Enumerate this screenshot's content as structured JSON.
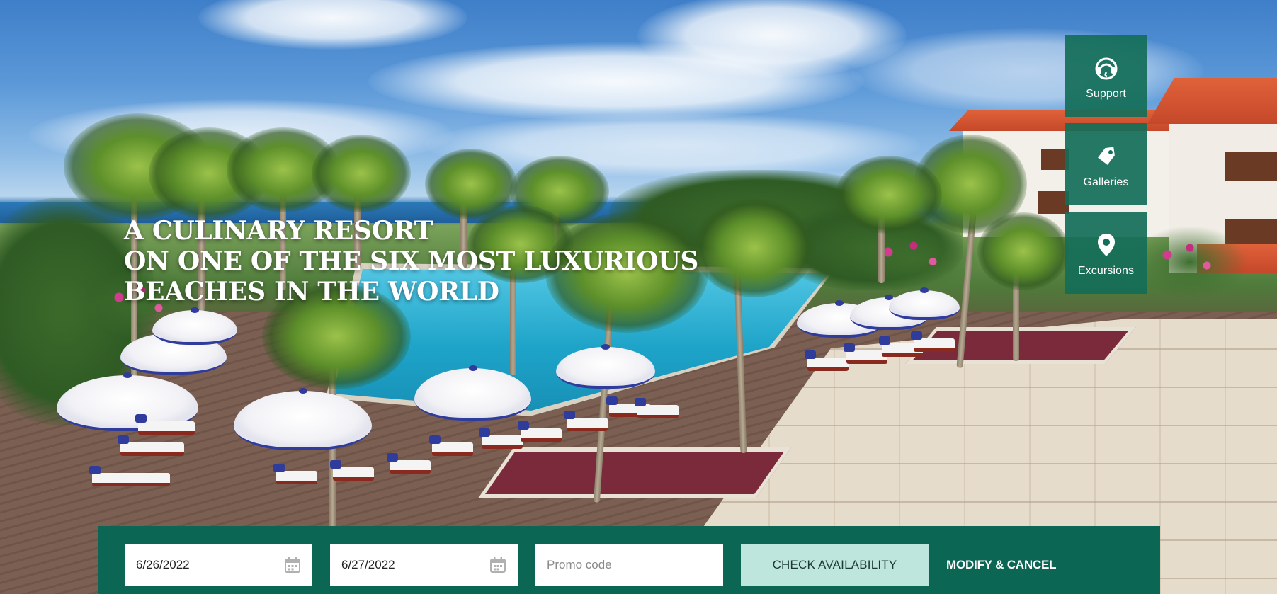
{
  "hero": {
    "headline_lines": [
      "A CULINARY RESORT",
      "ON ONE OF THE SIX MOST LUXURIOUS",
      "BEACHES IN THE WORLD"
    ]
  },
  "side_nav": {
    "items": [
      {
        "label": "Support",
        "icon": "headset-icon"
      },
      {
        "label": "Galleries",
        "icon": "tag-icon"
      },
      {
        "label": "Excursions",
        "icon": "map-pin-icon"
      }
    ]
  },
  "booking": {
    "arrival_date": "6/26/2022",
    "departure_date": "6/27/2022",
    "promo_placeholder": "Promo code",
    "promo_value": "",
    "check_availability_label": "CHECK AVAILABILITY",
    "modify_cancel_label": "MODIFY & CANCEL",
    "calendar_icon": "calendar-icon"
  },
  "colors": {
    "brand_green": "#0c6654",
    "side_nav_green": "#146e58",
    "button_mint": "#bfe6dc",
    "text_white": "#ffffff"
  }
}
